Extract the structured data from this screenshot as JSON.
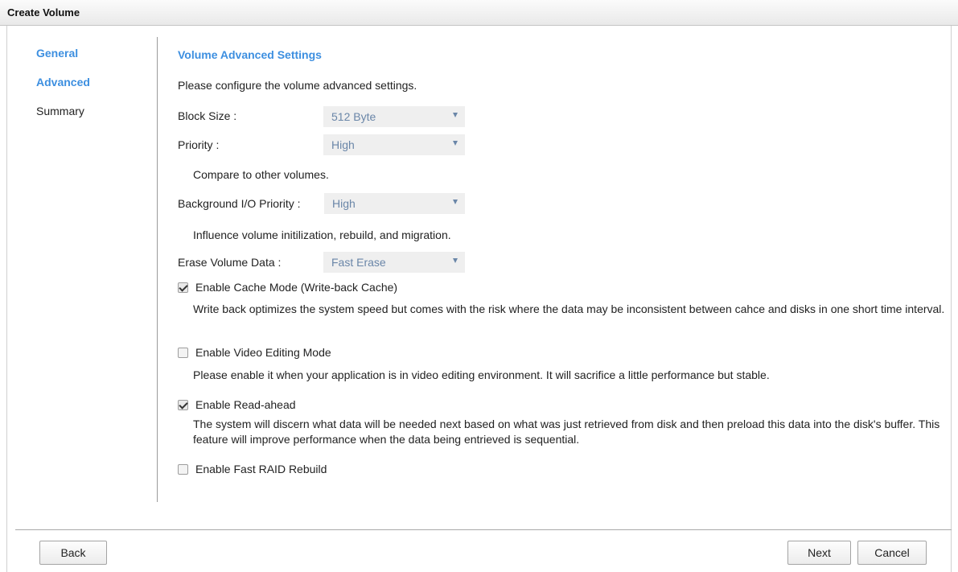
{
  "window": {
    "title": "Create Volume"
  },
  "steps": [
    {
      "label": "General",
      "active": true
    },
    {
      "label": "Advanced",
      "active": true
    },
    {
      "label": "Summary",
      "active": false
    }
  ],
  "section": {
    "title": "Volume Advanced Settings",
    "intro": "Please configure the volume advanced settings."
  },
  "fields": {
    "block_size": {
      "label": "Block Size :",
      "value": "512 Byte"
    },
    "priority": {
      "label": "Priority :",
      "value": "High",
      "hint": "Compare to other volumes."
    },
    "bg_priority": {
      "label": "Background I/O Priority :",
      "value": "High",
      "hint": "Influence volume initilization, rebuild, and migration."
    },
    "erase": {
      "label": "Erase Volume Data :",
      "value": "Fast Erase"
    }
  },
  "options": {
    "cache": {
      "label": "Enable Cache Mode (Write-back Cache)",
      "checked": true,
      "desc": "Write back optimizes the system speed but comes with the risk where the data may be inconsistent between cahce and disks in one short time interval."
    },
    "video": {
      "label": "Enable Video Editing Mode",
      "checked": false,
      "desc": "Please enable it when your application is in video editing environment. It will sacrifice a little performance but stable."
    },
    "readahead": {
      "label": "Enable Read-ahead",
      "checked": true,
      "desc": "The system will discern what data will be needed next based on what was just retrieved from disk and then preload this data into the disk's buffer. This feature will improve performance when the data being entrieved is sequential."
    },
    "fast_rebuild": {
      "label": "Enable Fast RAID Rebuild",
      "checked": false
    }
  },
  "buttons": {
    "back": "Back",
    "next": "Next",
    "cancel": "Cancel"
  },
  "colors": {
    "accent": "#3d8fe0",
    "select_text": "#6a86a8",
    "select_bg": "#efefef"
  }
}
